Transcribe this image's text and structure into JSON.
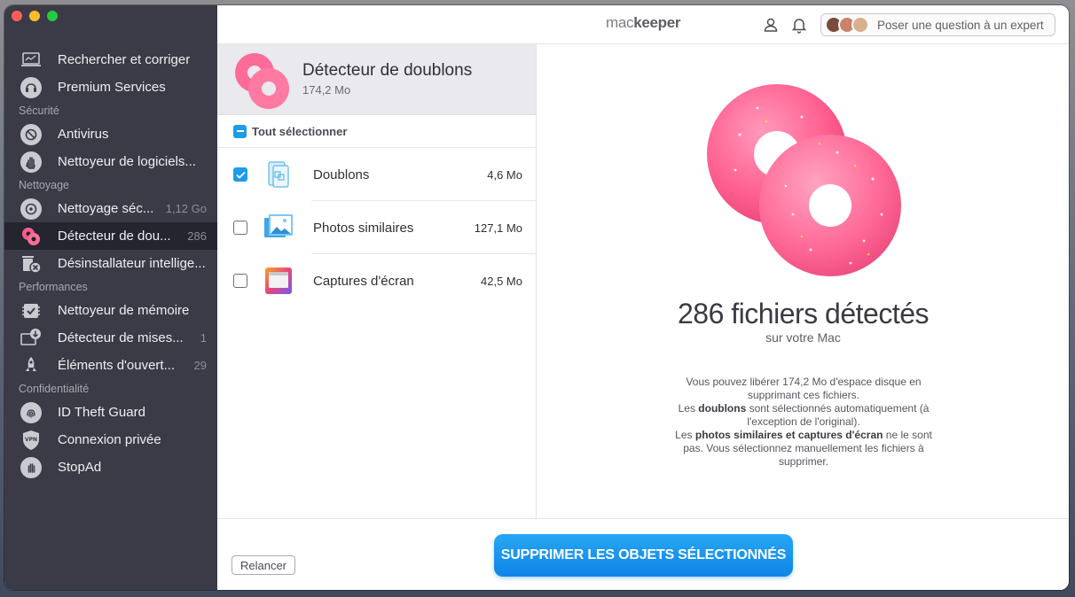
{
  "app": {
    "logo_light": "mac",
    "logo_bold": "keeper"
  },
  "topbar": {
    "expert_button": "Poser une question à un expert"
  },
  "sidebar": {
    "items": [
      {
        "label": "Rechercher et corriger",
        "icon": "laptop-scan-icon"
      },
      {
        "label": "Premium Services",
        "icon": "headset-icon"
      },
      {
        "section": "Sécurité"
      },
      {
        "label": "Antivirus",
        "icon": "antivirus-icon"
      },
      {
        "label": "Nettoyeur de logiciels...",
        "icon": "hand-stop-icon"
      },
      {
        "section": "Nettoyage"
      },
      {
        "label": "Nettoyage séc...",
        "count": "1,12 Go",
        "icon": "disk-cleanup-icon"
      },
      {
        "label": "Détecteur de dou...",
        "count": "286",
        "icon": "donut-icon",
        "active": true
      },
      {
        "label": "Désinstallateur intellige...",
        "icon": "trash-x-icon"
      },
      {
        "section": "Performances"
      },
      {
        "label": "Nettoyeur de mémoire",
        "icon": "memory-check-icon"
      },
      {
        "label": "Détecteur de mises...",
        "count": "1",
        "icon": "update-download-icon"
      },
      {
        "label": "Éléments d'ouvert...",
        "count": "29",
        "icon": "rocket-icon"
      },
      {
        "section": "Confidentialité"
      },
      {
        "label": "ID Theft Guard",
        "icon": "fingerprint-icon"
      },
      {
        "label": "Connexion privée",
        "icon": "vpn-shield-icon"
      },
      {
        "label": "StopAd",
        "icon": "stop-hand-icon"
      }
    ]
  },
  "list": {
    "title": "Détecteur de doublons",
    "size": "174,2 Mo",
    "select_all": "Tout sélectionner",
    "rows": [
      {
        "label": "Doublons",
        "size": "4,6 Mo",
        "checked": true
      },
      {
        "label": "Photos similaires",
        "size": "127,1 Mo",
        "checked": false
      },
      {
        "label": "Captures d'écran",
        "size": "42,5 Mo",
        "checked": false
      }
    ]
  },
  "detail": {
    "headline": "286 fichiers détectés",
    "subheadline": "sur votre Mac",
    "desc_line1": "Vous pouvez libérer 174,2 Mo d'espace disque en supprimant ces fichiers.",
    "desc_line2_pre": "Les ",
    "desc_line2_bold": "doublons",
    "desc_line2_post": " sont sélectionnés automatiquement (à l'exception de l'original).",
    "desc_line3_pre": "Les ",
    "desc_line3_bold": "photos similaires et captures d'écran",
    "desc_line3_post": " ne le sont pas. Vous sélectionnez manuellement les fichiers à supprimer."
  },
  "bottom": {
    "retry": "Relancer",
    "delete": "SUPPRIMER LES OBJETS SÉLECTIONNÉS"
  },
  "colors": {
    "accent": "#1e9be9",
    "sidebar_bg": "#3a3b46",
    "donut_pink": "#ff5a8c"
  }
}
